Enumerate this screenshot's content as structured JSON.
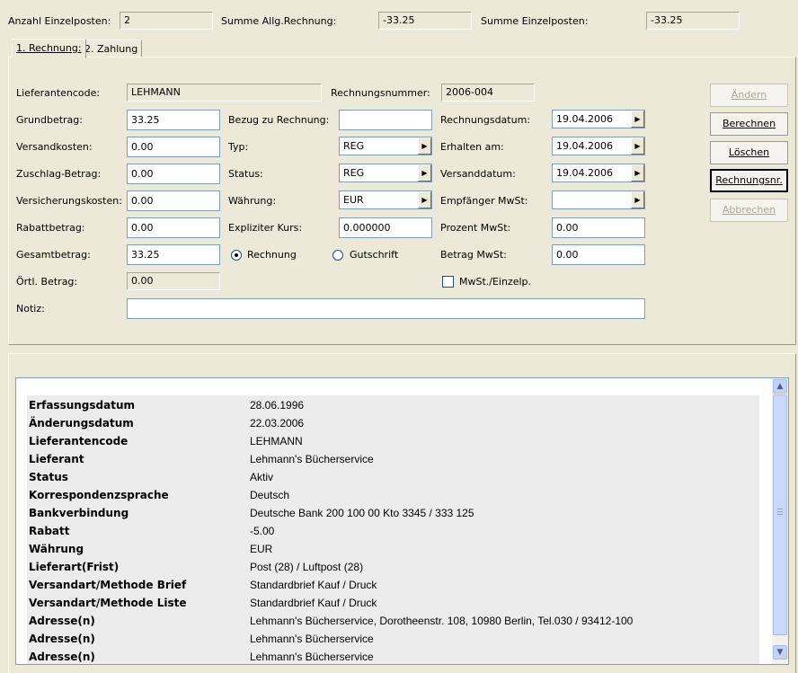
{
  "summary": {
    "count_label": "Anzahl Einzelposten:",
    "count_value": "2",
    "sum_invoice_label": "Summe Allg.Rechnung:",
    "sum_invoice_value": "-33.25",
    "sum_items_label": "Summe Einzelposten:",
    "sum_items_value": "-33.25"
  },
  "tabs": [
    {
      "label": "1. Rechnung:"
    },
    {
      "label": "2. Zahlung"
    }
  ],
  "form": {
    "supplier_code_label": "Lieferantencode:",
    "supplier_code_value": "LEHMANN",
    "invoice_no_label": "Rechnungsnummer:",
    "invoice_no_value": "2006-004",
    "base_amount_label": "Grundbetrag:",
    "base_amount_value": "33.25",
    "shipping_label": "Versandkosten:",
    "shipping_value": "0.00",
    "surcharge_label": "Zuschlag-Betrag:",
    "surcharge_value": "0.00",
    "insurance_label": "Versicherungskosten:",
    "insurance_value": "0.00",
    "discount_label": "Rabattbetrag:",
    "discount_value": "0.00",
    "total_label": "Gesamtbetrag:",
    "total_value": "33.25",
    "local_amount_label": "Örtl. Betrag:",
    "local_amount_value": "0.00",
    "note_label": "Notiz:",
    "note_value": "",
    "ref_invoice_label": "Bezug zu Rechnung:",
    "ref_invoice_value": "",
    "type_label": "Typ:",
    "type_value": "REG",
    "status_label": "Status:",
    "status_value": "REG",
    "currency_label": "Währung:",
    "currency_value": "EUR",
    "explicit_rate_label": "Expliziter Kurs:",
    "explicit_rate_value": "0.000000",
    "radio_invoice_label": "Rechnung",
    "radio_credit_label": "Gutschrift",
    "invoice_date_label": "Rechnungsdatum:",
    "invoice_date_value": "19.04.2006",
    "received_label": "Erhalten am:",
    "received_value": "19.04.2006",
    "ship_date_label": "Versanddatum:",
    "ship_date_value": "19.04.2006",
    "recipient_vat_label": "Empfänger MwSt:",
    "recipient_vat_value": "",
    "vat_percent_label": "Prozent MwSt:",
    "vat_percent_value": "0.00",
    "vat_amount_label": "Betrag MwSt:",
    "vat_amount_value": "0.00",
    "vat_per_item_label": "MwSt./Einzelp."
  },
  "buttons": {
    "change": "Ändern",
    "calculate": "Berechnen",
    "delete": "Löschen",
    "invoice_no": "Rechnungsnr.",
    "cancel": "Abbrechen"
  },
  "info_rows": [
    {
      "key": "Erfassungsdatum",
      "value": "28.06.1996"
    },
    {
      "key": "Änderungsdatum",
      "value": "22.03.2006"
    },
    {
      "key": "Lieferantencode",
      "value": "LEHMANN"
    },
    {
      "key": "Lieferant",
      "value": "Lehmann's Bücherservice"
    },
    {
      "key": "Status",
      "value": "Aktiv"
    },
    {
      "key": "Korrespondenzsprache",
      "value": "Deutsch"
    },
    {
      "key": "Bankverbindung",
      "value": "Deutsche Bank 200 100 00 Kto 3345 / 333 125"
    },
    {
      "key": "Rabatt",
      "value": "-5.00"
    },
    {
      "key": "Währung",
      "value": "EUR"
    },
    {
      "key": "Lieferart(Frist)",
      "value": "Post (28) / Luftpost (28)"
    },
    {
      "key": "Versandart/Methode Brief",
      "value": "Standardbrief Kauf / Druck"
    },
    {
      "key": "Versandart/Methode Liste",
      "value": "Standardbrief Kauf / Druck"
    },
    {
      "key": "Adresse(n)",
      "value": "Lehmann's Bücherservice, Dorotheenstr. 108, 10980 Berlin, Tel.030 / 93412-100"
    },
    {
      "key": "Adresse(n)",
      "value": "Lehmann's Bücherservice"
    },
    {
      "key": "Adresse(n)",
      "value": "Lehmann's Bücherservice"
    }
  ],
  "icons": {
    "dropdown_arrow": "arrow-right-icon",
    "scroll_up": "chevron-up-icon",
    "scroll_down": "chevron-down-icon"
  }
}
